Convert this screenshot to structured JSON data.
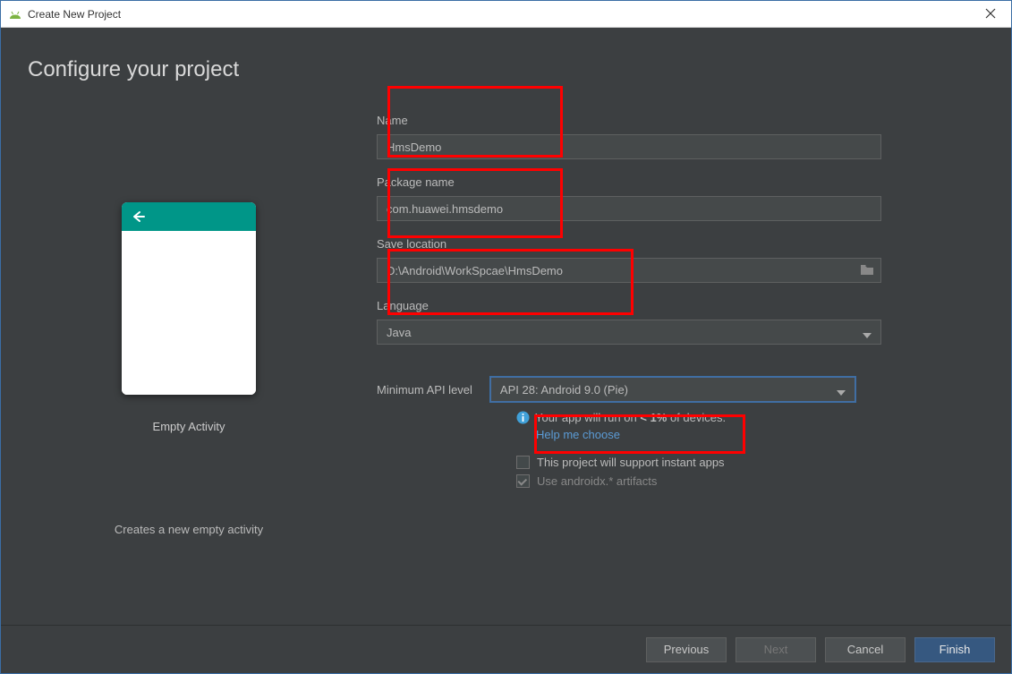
{
  "window": {
    "title": "Create New Project"
  },
  "page": {
    "heading": "Configure your project"
  },
  "preview": {
    "caption": "Empty Activity",
    "description": "Creates a new empty activity"
  },
  "form": {
    "name": {
      "label": "Name",
      "value": "HmsDemo"
    },
    "package": {
      "label": "Package name",
      "value": "com.huawei.hmsdemo"
    },
    "location": {
      "label": "Save location",
      "value": "D:\\Android\\WorkSpcae\\HmsDemo"
    },
    "language": {
      "label": "Language",
      "value": "Java"
    },
    "api": {
      "label": "Minimum API level",
      "value": "API 28: Android 9.0 (Pie)"
    }
  },
  "info": {
    "devices_prefix": "Your app will run on ",
    "devices_bold": "< 1%",
    "devices_suffix": " of devices.",
    "help_link": "Help me choose",
    "instant_apps": "This project will support instant apps",
    "androidx": "Use androidx.* artifacts"
  },
  "buttons": {
    "previous": "Previous",
    "next": "Next",
    "cancel": "Cancel",
    "finish": "Finish"
  }
}
